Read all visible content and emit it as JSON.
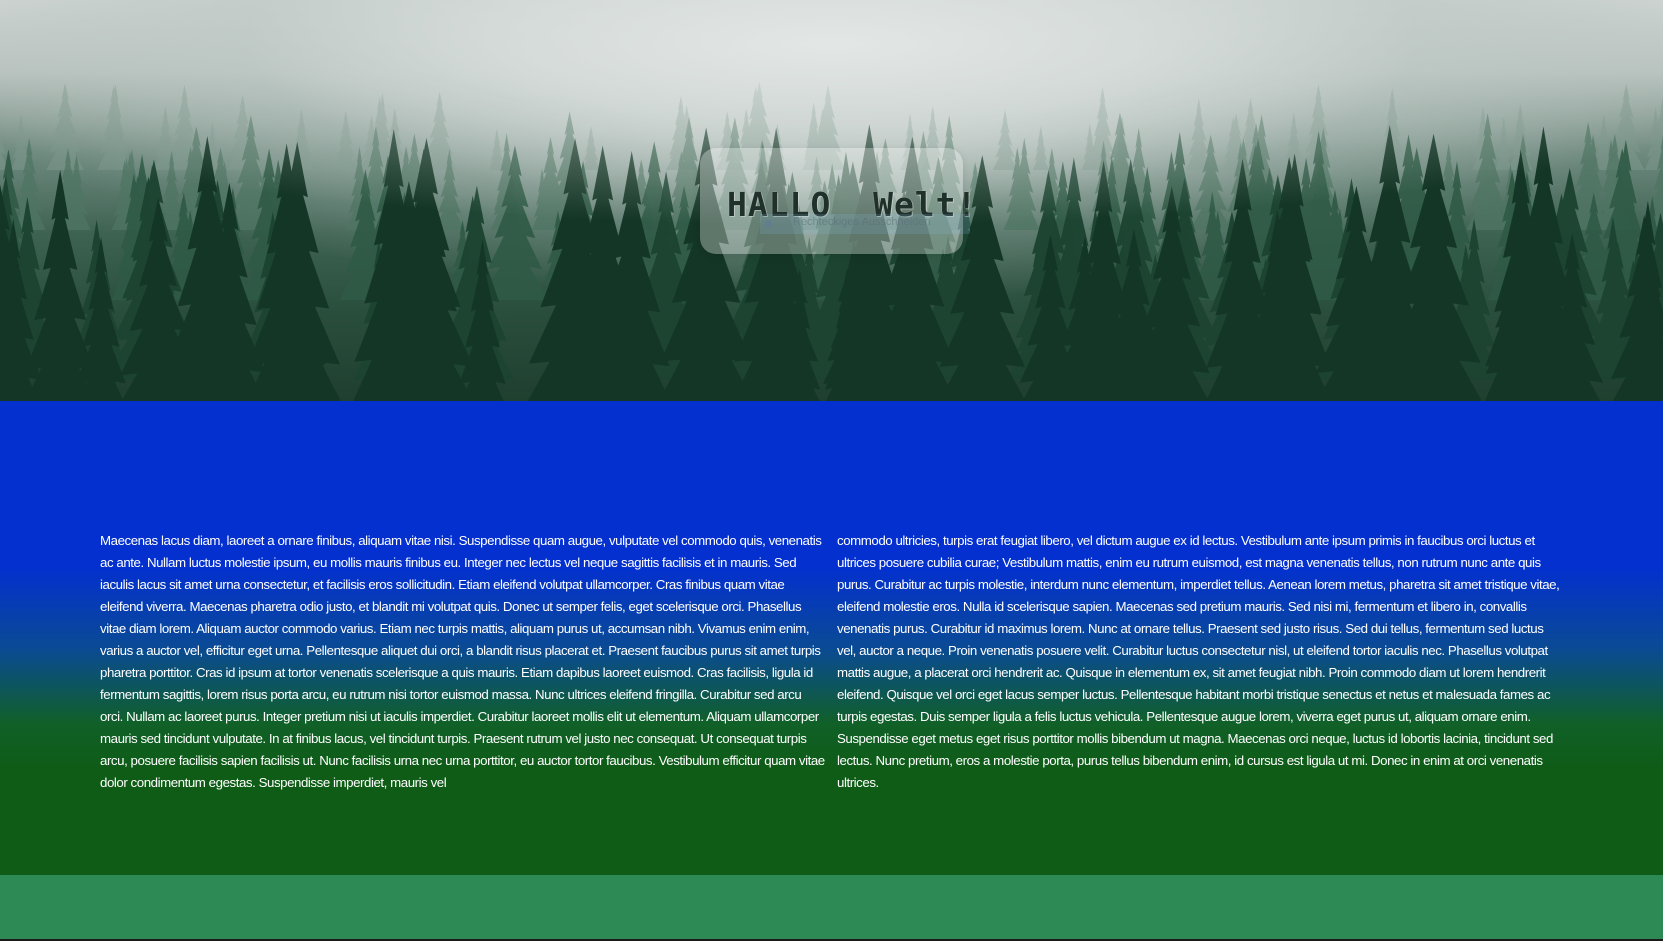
{
  "hero": {
    "title": "HALLO  Welt!",
    "overlay_tooltip": "Rechteckiges Ausschneiden"
  },
  "content": {
    "column_left": "Maecenas lacus diam, laoreet a ornare finibus, aliquam vitae nisi. Suspendisse quam augue, vulputate vel commodo quis, venenatis ac ante. Nullam luctus molestie ipsum, eu mollis mauris finibus eu. Integer nec lectus vel neque sagittis facilisis et in mauris. Sed iaculis lacus sit amet urna consectetur, et facilisis eros sollicitudin. Etiam eleifend volutpat ullamcorper. Cras finibus quam vitae eleifend viverra. Maecenas pharetra odio justo, et blandit mi volutpat quis. Donec ut semper felis, eget scelerisque orci. Phasellus vitae diam lorem. Aliquam auctor commodo varius. Etiam nec turpis mattis, aliquam purus ut, accumsan nibh. Vivamus enim enim, varius a auctor vel, efficitur eget urna. Pellentesque aliquet dui orci, a blandit risus placerat et. Praesent faucibus purus sit amet turpis pharetra porttitor. Cras id ipsum at tortor venenatis scelerisque a quis mauris. Etiam dapibus laoreet euismod. Cras facilisis, ligula id fermentum sagittis, lorem risus porta arcu, eu rutrum nisi tortor euismod massa. Nunc ultrices eleifend fringilla. Curabitur sed arcu orci. Nullam ac laoreet purus. Integer pretium nisi ut iaculis imperdiet. Curabitur laoreet mollis elit ut elementum. Aliquam ullamcorper mauris sed tincidunt vulputate. In at finibus lacus, vel tincidunt turpis. Praesent rutrum vel justo nec consequat. Ut consequat turpis arcu, posuere facilisis sapien facilisis ut. Nunc facilisis urna nec urna porttitor, eu auctor tortor faucibus. Vestibulum efficitur quam vitae dolor condimentum egestas. Suspendisse imperdiet, mauris vel",
    "column_right": "commodo ultricies, turpis erat feugiat libero, vel dictum augue ex id lectus. Vestibulum ante ipsum primis in faucibus orci luctus et ultrices posuere cubilia curae; Vestibulum mattis, enim eu rutrum euismod, est magna venenatis tellus, non rutrum nunc ante quis purus. Curabitur ac turpis molestie, interdum nunc elementum, imperdiet tellus. Aenean lorem metus, pharetra sit amet tristique vitae, eleifend molestie eros. Nulla id scelerisque sapien. Maecenas sed pretium mauris. Sed nisi mi, fermentum et libero in, convallis venenatis purus. Curabitur id maximus lorem. Nunc at ornare tellus. Praesent sed justo risus. Sed dui tellus, fermentum sed luctus vel, auctor a neque. Proin venenatis posuere velit. Curabitur luctus consectetur nisl, ut eleifend tortor iaculis nec. Phasellus volutpat mattis augue, a placerat orci hendrerit ac. Quisque in elementum ex, sit amet feugiat nibh. Proin commodo diam ut lorem hendrerit eleifend. Quisque vel orci eget lacus semper luctus. Pellentesque habitant morbi tristique senectus et netus et malesuada fames ac turpis egestas. Duis semper ligula a felis luctus vehicula. Pellentesque augue lorem, viverra eget purus ut, aliquam ornare enim. Suspendisse eget metus eget risus porttitor mollis bibendum ut magna. Maecenas orci neque, luctus id lobortis lacinia, tincidunt sed lectus. Nunc pretium, eros a molestie porta, purus tellus bibendum enim, id cursus est ligula ut mi. Donec in enim at orci venenatis ultrices."
  },
  "colors": {
    "main_blue": "#0330cf",
    "main_green": "#0f5c16",
    "footer_green": "#2e8a55"
  }
}
